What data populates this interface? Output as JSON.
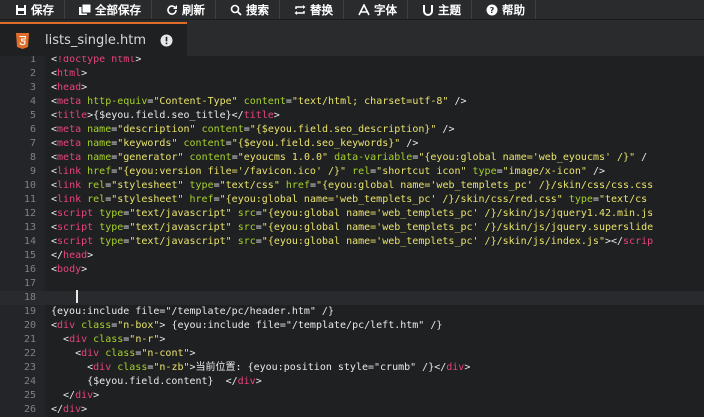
{
  "toolbar": {
    "buttons": [
      {
        "label": "保存",
        "icon": "save-icon"
      },
      {
        "label": "全部保存",
        "icon": "save-all-icon"
      },
      {
        "label": "刷新",
        "icon": "refresh-icon"
      },
      {
        "label": "搜索",
        "icon": "search-icon"
      },
      {
        "label": "替换",
        "icon": "replace-icon"
      },
      {
        "label": "字体",
        "icon": "font-icon"
      },
      {
        "label": "主题",
        "icon": "theme-icon"
      },
      {
        "label": "帮助",
        "icon": "help-icon"
      }
    ]
  },
  "tab": {
    "filename": "lists_single.htm",
    "accent": "#e06c2a"
  },
  "editor": {
    "colors": {
      "tag": "#e8447a",
      "attribute": "#a6d12a",
      "string": "#e9e36b",
      "text": "#e9e9e9",
      "gutter_text": "#7f8185"
    },
    "lines": [
      {
        "n": "1",
        "segs": [
          [
            "p",
            "<"
          ],
          [
            "t",
            "!doctype html"
          ],
          [
            "p",
            ">"
          ]
        ]
      },
      {
        "n": "2",
        "segs": [
          [
            "p",
            "<"
          ],
          [
            "t",
            "html"
          ],
          [
            "p",
            ">"
          ]
        ]
      },
      {
        "n": "3",
        "segs": [
          [
            "p",
            "<"
          ],
          [
            "t",
            "head"
          ],
          [
            "p",
            ">"
          ]
        ]
      },
      {
        "n": "4",
        "segs": [
          [
            "p",
            "<"
          ],
          [
            "t",
            "meta "
          ],
          [
            "a",
            "http-equiv"
          ],
          [
            "p",
            "="
          ],
          [
            "s",
            "\"Content-Type\""
          ],
          [
            "p",
            " "
          ],
          [
            "a",
            "content"
          ],
          [
            "p",
            "="
          ],
          [
            "s",
            "\"text/html; charset=utf-8\""
          ],
          [
            "p",
            " />"
          ]
        ]
      },
      {
        "n": "5",
        "segs": [
          [
            "p",
            "<"
          ],
          [
            "t",
            "title"
          ],
          [
            "p",
            ">{$eyou.field.seo_title}</"
          ],
          [
            "t",
            "title"
          ],
          [
            "p",
            ">"
          ]
        ]
      },
      {
        "n": "6",
        "segs": [
          [
            "p",
            "<"
          ],
          [
            "t",
            "meta "
          ],
          [
            "a",
            "name"
          ],
          [
            "p",
            "="
          ],
          [
            "s",
            "\"description\""
          ],
          [
            "p",
            " "
          ],
          [
            "a",
            "content"
          ],
          [
            "p",
            "="
          ],
          [
            "s",
            "\"{$eyou.field.seo_description}\""
          ],
          [
            "p",
            " />"
          ]
        ]
      },
      {
        "n": "7",
        "segs": [
          [
            "p",
            "<"
          ],
          [
            "t",
            "meta "
          ],
          [
            "a",
            "name"
          ],
          [
            "p",
            "="
          ],
          [
            "s",
            "\"keywords\""
          ],
          [
            "p",
            " "
          ],
          [
            "a",
            "content"
          ],
          [
            "p",
            "="
          ],
          [
            "s",
            "\"{$eyou.field.seo_keywords}\""
          ],
          [
            "p",
            " />"
          ]
        ]
      },
      {
        "n": "8",
        "segs": [
          [
            "p",
            "<"
          ],
          [
            "t",
            "meta "
          ],
          [
            "a",
            "name"
          ],
          [
            "p",
            "="
          ],
          [
            "s",
            "\"generator\""
          ],
          [
            "p",
            " "
          ],
          [
            "a",
            "content"
          ],
          [
            "p",
            "="
          ],
          [
            "s",
            "\"eyoucms 1.0.0\""
          ],
          [
            "p",
            " "
          ],
          [
            "a",
            "data-variable"
          ],
          [
            "p",
            "="
          ],
          [
            "s",
            "\"{eyou:global name='web_eyoucms' /}\""
          ],
          [
            "p",
            " /"
          ]
        ]
      },
      {
        "n": "9",
        "segs": [
          [
            "p",
            "<"
          ],
          [
            "t",
            "link "
          ],
          [
            "a",
            "href"
          ],
          [
            "p",
            "="
          ],
          [
            "s",
            "\"{eyou:version file='/favicon.ico' /}\""
          ],
          [
            "p",
            " "
          ],
          [
            "a",
            "rel"
          ],
          [
            "p",
            "="
          ],
          [
            "s",
            "\"shortcut icon\""
          ],
          [
            "p",
            " "
          ],
          [
            "a",
            "type"
          ],
          [
            "p",
            "="
          ],
          [
            "s",
            "\"image/x-icon\""
          ],
          [
            "p",
            " />"
          ]
        ]
      },
      {
        "n": "10",
        "segs": [
          [
            "p",
            "<"
          ],
          [
            "t",
            "link "
          ],
          [
            "a",
            "rel"
          ],
          [
            "p",
            "="
          ],
          [
            "s",
            "\"stylesheet\""
          ],
          [
            "p",
            " "
          ],
          [
            "a",
            "type"
          ],
          [
            "p",
            "="
          ],
          [
            "s",
            "\"text/css\""
          ],
          [
            "p",
            " "
          ],
          [
            "a",
            "href"
          ],
          [
            "p",
            "="
          ],
          [
            "s",
            "\"{eyou:global name='web_templets_pc' /}/skin/css/css.css"
          ]
        ]
      },
      {
        "n": "11",
        "segs": [
          [
            "p",
            "<"
          ],
          [
            "t",
            "link "
          ],
          [
            "a",
            "rel"
          ],
          [
            "p",
            "="
          ],
          [
            "s",
            "\"stylesheet\""
          ],
          [
            "p",
            " "
          ],
          [
            "a",
            "href"
          ],
          [
            "p",
            "="
          ],
          [
            "s",
            "\"{eyou:global name='web_templets_pc' /}/skin/css/red.css\""
          ],
          [
            "p",
            " "
          ],
          [
            "a",
            "type"
          ],
          [
            "p",
            "="
          ],
          [
            "s",
            "\"text/cs"
          ]
        ]
      },
      {
        "n": "12",
        "segs": [
          [
            "p",
            "<"
          ],
          [
            "t",
            "script "
          ],
          [
            "a",
            "type"
          ],
          [
            "p",
            "="
          ],
          [
            "s",
            "\"text/javascript\""
          ],
          [
            "p",
            " "
          ],
          [
            "a",
            "src"
          ],
          [
            "p",
            "="
          ],
          [
            "s",
            "\"{eyou:global name='web_templets_pc' /}/skin/js/jquery1.42.min.js"
          ]
        ]
      },
      {
        "n": "13",
        "segs": [
          [
            "p",
            "<"
          ],
          [
            "t",
            "script "
          ],
          [
            "a",
            "type"
          ],
          [
            "p",
            "="
          ],
          [
            "s",
            "\"text/javascript\""
          ],
          [
            "p",
            " "
          ],
          [
            "a",
            "src"
          ],
          [
            "p",
            "="
          ],
          [
            "s",
            "\"{eyou:global name='web_templets_pc' /}/skin/js/jquery.superslide"
          ]
        ]
      },
      {
        "n": "14",
        "segs": [
          [
            "p",
            "<"
          ],
          [
            "t",
            "script "
          ],
          [
            "a",
            "type"
          ],
          [
            "p",
            "="
          ],
          [
            "s",
            "\"text/javascript\""
          ],
          [
            "p",
            " "
          ],
          [
            "a",
            "src"
          ],
          [
            "p",
            "="
          ],
          [
            "s",
            "\"{eyou:global name='web_templets_pc' /}/skin/js/index.js\""
          ],
          [
            "p",
            "></"
          ],
          [
            "t",
            "scrip"
          ]
        ]
      },
      {
        "n": "15",
        "segs": [
          [
            "p",
            "</"
          ],
          [
            "t",
            "head"
          ],
          [
            "p",
            ">"
          ]
        ]
      },
      {
        "n": "16",
        "segs": [
          [
            "p",
            "<"
          ],
          [
            "t",
            "body"
          ],
          [
            "p",
            ">"
          ]
        ]
      },
      {
        "n": "17",
        "segs": []
      },
      {
        "n": "18",
        "segs": []
      },
      {
        "n": "19",
        "segs": [
          [
            "p",
            "{eyou:include file=\"/template/pc/header.htm\" /}"
          ]
        ]
      },
      {
        "n": "20",
        "segs": [
          [
            "p",
            "<"
          ],
          [
            "t",
            "div "
          ],
          [
            "a",
            "class"
          ],
          [
            "p",
            "="
          ],
          [
            "s",
            "\"n-box\""
          ],
          [
            "p",
            "> {eyou:include file=\"/template/pc/left.htm\" /}"
          ]
        ]
      },
      {
        "n": "21",
        "segs": [
          [
            "p",
            "  <"
          ],
          [
            "t",
            "div "
          ],
          [
            "a",
            "class"
          ],
          [
            "p",
            "="
          ],
          [
            "s",
            "\"n-r\""
          ],
          [
            "p",
            ">"
          ]
        ]
      },
      {
        "n": "22",
        "segs": [
          [
            "p",
            "    <"
          ],
          [
            "t",
            "div "
          ],
          [
            "a",
            "class"
          ],
          [
            "p",
            "="
          ],
          [
            "s",
            "\"n-cont\""
          ],
          [
            "p",
            ">"
          ]
        ]
      },
      {
        "n": "23",
        "segs": [
          [
            "p",
            "      <"
          ],
          [
            "t",
            "div "
          ],
          [
            "a",
            "class"
          ],
          [
            "p",
            "="
          ],
          [
            "s",
            "\"n-zb\""
          ],
          [
            "p",
            ">当前位置: {eyou:position style=\"crumb\" /}</"
          ],
          [
            "t",
            "div"
          ],
          [
            "p",
            ">"
          ]
        ]
      },
      {
        "n": "24",
        "segs": [
          [
            "p",
            "      {$eyou.field.content}  </"
          ],
          [
            "t",
            "div"
          ],
          [
            "p",
            ">"
          ]
        ]
      },
      {
        "n": "25",
        "segs": [
          [
            "p",
            "  </"
          ],
          [
            "t",
            "div"
          ],
          [
            "p",
            ">"
          ]
        ]
      },
      {
        "n": "26",
        "segs": [
          [
            "p",
            "</"
          ],
          [
            "t",
            "div"
          ],
          [
            "p",
            ">"
          ]
        ]
      }
    ]
  }
}
